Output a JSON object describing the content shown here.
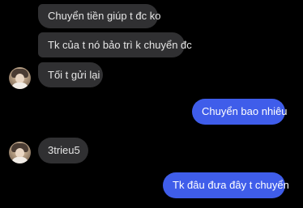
{
  "conversation": {
    "messages": [
      {
        "sender": "contact",
        "text": "Chuyển tiền giúp t đc ko"
      },
      {
        "sender": "contact",
        "text": "Tk của t nó bảo trì k chuyển đc"
      },
      {
        "sender": "contact",
        "text": "Tối t gửi lại"
      },
      {
        "sender": "me",
        "text": "Chuyển bao nhiêu"
      },
      {
        "sender": "contact",
        "text": "3trieu5"
      },
      {
        "sender": "me",
        "text": "Tk đâu đưa đây t chuyển"
      }
    ]
  },
  "colors": {
    "background": "#000000",
    "incoming_bubble": "#303032",
    "outgoing_bubble": "#3f5dea",
    "incoming_text": "#e6e6e6",
    "outgoing_text": "#ffffff"
  },
  "icons": {
    "contact_avatar": "avatar-icon"
  }
}
